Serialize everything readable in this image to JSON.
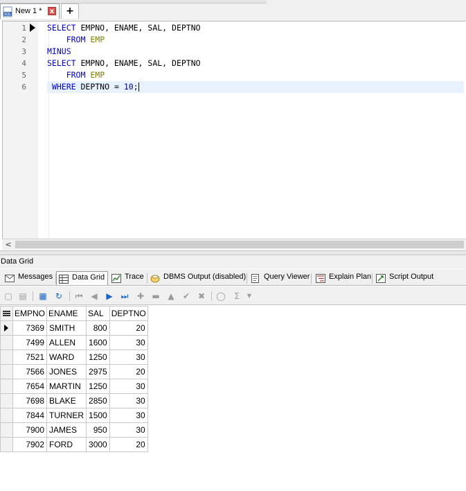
{
  "document_tab": {
    "label": "New 1 *",
    "close_glyph": "x",
    "add_glyph": "+"
  },
  "editor": {
    "line_numbers": [
      "1",
      "2",
      "3",
      "4",
      "5",
      "6"
    ],
    "lines": [
      [
        {
          "t": "SELECT",
          "c": "kw"
        },
        {
          "t": " EMPNO, ENAME, SAL, DEPTNO",
          "c": ""
        }
      ],
      [
        {
          "t": "    ",
          "c": ""
        },
        {
          "t": "FROM",
          "c": "kw"
        },
        {
          "t": " ",
          "c": ""
        },
        {
          "t": "EMP",
          "c": "tbl"
        }
      ],
      [
        {
          "t": "MINUS",
          "c": "kw"
        }
      ],
      [
        {
          "t": "SELECT",
          "c": "kw"
        },
        {
          "t": " EMPNO, ENAME, SAL, DEPTNO",
          "c": ""
        }
      ],
      [
        {
          "t": "    ",
          "c": ""
        },
        {
          "t": "FROM",
          "c": "kw"
        },
        {
          "t": " ",
          "c": ""
        },
        {
          "t": "EMP",
          "c": "tbl"
        }
      ],
      [
        {
          "t": " ",
          "c": ""
        },
        {
          "t": "WHERE",
          "c": "kw"
        },
        {
          "t": " DEPTNO = ",
          "c": ""
        },
        {
          "t": "10;",
          "c": "num"
        }
      ]
    ],
    "current_line": 6,
    "scroll_left_glyph": "<"
  },
  "results": {
    "panel_title": "Data Grid",
    "tabs": [
      {
        "label": "Messages",
        "icon": "messages-icon"
      },
      {
        "label": "Data Grid",
        "icon": "data-grid-icon",
        "active": true
      },
      {
        "label": "Trace",
        "icon": "trace-icon"
      },
      {
        "label": "DBMS Output (disabled)",
        "icon": "dbms-output-icon"
      },
      {
        "label": "Query Viewer",
        "icon": "query-viewer-icon"
      },
      {
        "label": "Explain Plan",
        "icon": "explain-plan-icon"
      },
      {
        "label": "Script Output",
        "icon": "script-output-icon"
      }
    ],
    "grid": {
      "columns": [
        "EMPNO",
        "ENAME",
        "SAL",
        "DEPTNO"
      ],
      "rows": [
        [
          "7369",
          "SMITH",
          "800",
          "20"
        ],
        [
          "7499",
          "ALLEN",
          "1600",
          "30"
        ],
        [
          "7521",
          "WARD",
          "1250",
          "30"
        ],
        [
          "7566",
          "JONES",
          "2975",
          "20"
        ],
        [
          "7654",
          "MARTIN",
          "1250",
          "30"
        ],
        [
          "7698",
          "BLAKE",
          "2850",
          "30"
        ],
        [
          "7844",
          "TURNER",
          "1500",
          "30"
        ],
        [
          "7900",
          "JAMES",
          "950",
          "30"
        ],
        [
          "7902",
          "FORD",
          "3000",
          "20"
        ]
      ],
      "current_row": 0
    }
  }
}
